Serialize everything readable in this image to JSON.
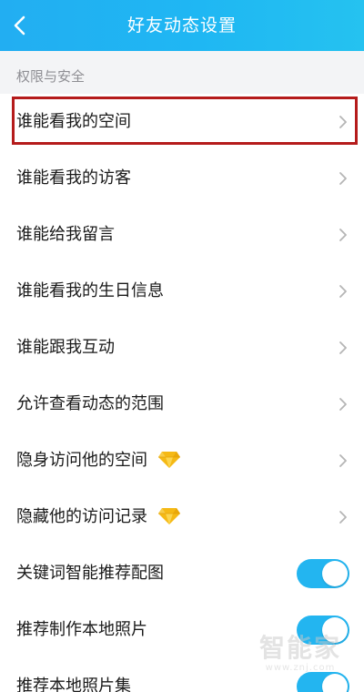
{
  "header": {
    "title": "好友动态设置",
    "back_icon": "chevron-left-icon",
    "background": "#22aef2"
  },
  "section": {
    "label": "权限与安全"
  },
  "rows": [
    {
      "label": "谁能看我的空间",
      "control": "chevron",
      "highlighted": true
    },
    {
      "label": "谁能看我的访客",
      "control": "chevron"
    },
    {
      "label": "谁能给我留言",
      "control": "chevron"
    },
    {
      "label": "谁能看我的生日信息",
      "control": "chevron"
    },
    {
      "label": "谁能跟我互动",
      "control": "chevron"
    },
    {
      "label": "允许查看动态的范围",
      "control": "chevron"
    },
    {
      "label": "隐身访问他的空间",
      "control": "chevron",
      "badge": "diamond-icon"
    },
    {
      "label": "隐藏他的访问记录",
      "control": "chevron",
      "badge": "diamond-icon"
    },
    {
      "label": "关键词智能推荐配图",
      "control": "toggle",
      "toggle_on": true
    },
    {
      "label": "推荐制作本地照片",
      "control": "toggle",
      "toggle_on": true
    },
    {
      "label": "推荐本地照片集",
      "control": "toggle",
      "toggle_on": true
    }
  ],
  "watermark": {
    "text": "智能家",
    "url": "www.znj.com"
  },
  "colors": {
    "accent": "#23b5f0",
    "highlight_border": "#b51b1b",
    "section_bg": "#f3f4f6"
  }
}
